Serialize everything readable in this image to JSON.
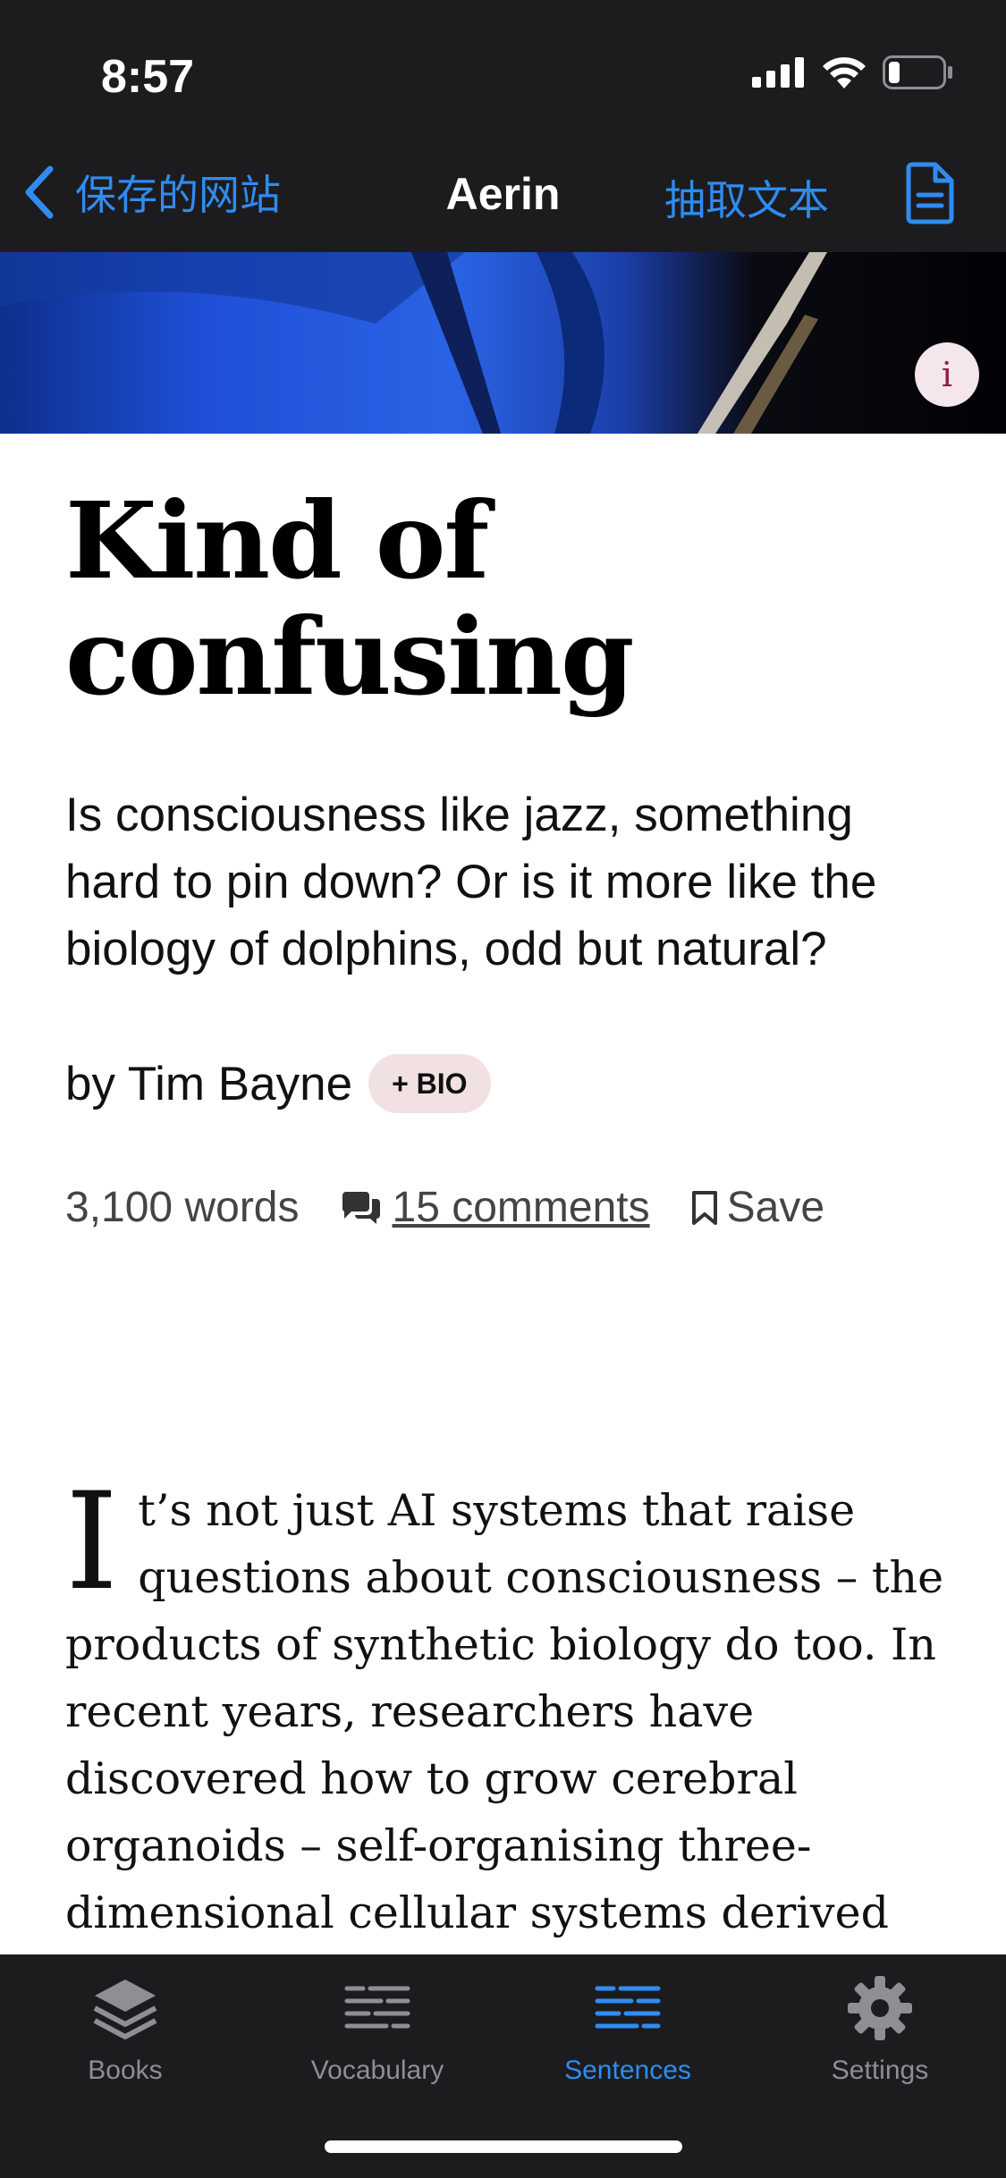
{
  "status_bar": {
    "time": "8:57"
  },
  "nav": {
    "back_label": "保存的网站",
    "title": "Aerin",
    "extract_label": "抽取文本"
  },
  "hero": {
    "info_label": "i"
  },
  "article": {
    "title_line1": "Kind of",
    "title_line2": "confusing",
    "subtitle": "Is consciousness like jazz, something hard to pin down? Or is it more like the biology of dolphins, odd but natural?",
    "byline": "by Tim Bayne",
    "bio_badge": "+ BIO",
    "word_count": "3,100 words",
    "comments": "15 comments",
    "save": "Save",
    "dropcap": "I",
    "body": "t’s not just AI systems that raise questions about consciousness – the products of synthetic biology do too. In recent years, researchers have discovered how to grow cerebral organoids – self-organising three-dimensional cellular systems derived either from human"
  },
  "tabs": [
    {
      "label": "Books",
      "icon": "books-stack-icon",
      "active": false
    },
    {
      "label": "Vocabulary",
      "icon": "vocabulary-lines-icon",
      "active": false
    },
    {
      "label": "Sentences",
      "icon": "sentences-lines-icon",
      "active": true
    },
    {
      "label": "Settings",
      "icon": "gear-icon",
      "active": false
    }
  ],
  "colors": {
    "accent": "#2f8cf0",
    "bar_bg": "#1c1c1e",
    "badge_bg": "#f2e1e3"
  }
}
